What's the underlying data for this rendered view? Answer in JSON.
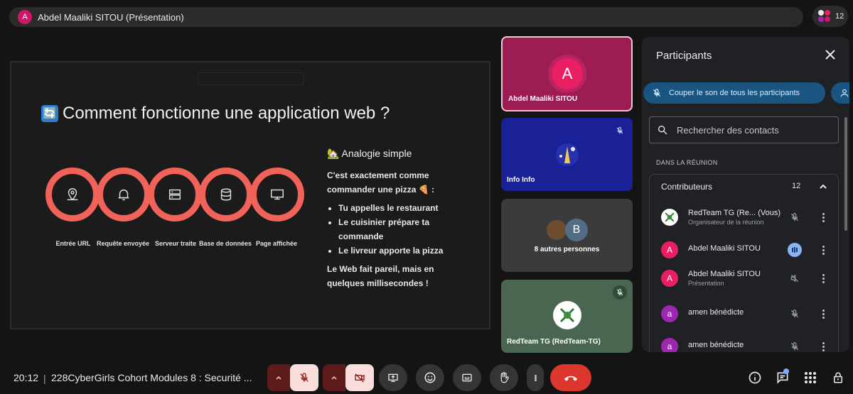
{
  "presenter_bar": {
    "avatar_letter": "A",
    "title": "Abdel Maaliki SITOU (Présentation)"
  },
  "people_chip": {
    "count": "12"
  },
  "slide": {
    "title": "Comment fonctionne une application web ?",
    "title_icon": "🔄",
    "steps": [
      {
        "label": "Entrée URL",
        "icon": "location-icon"
      },
      {
        "label": "Requête envoyée",
        "icon": "bell-icon"
      },
      {
        "label": "Serveur traite",
        "icon": "server-icon"
      },
      {
        "label": "Base de données",
        "icon": "database-icon"
      },
      {
        "label": "Page affichée",
        "icon": "monitor-icon"
      }
    ],
    "analogy": {
      "heading": "🏡 Analogie simple",
      "intro": "C'est exactement comme commander une pizza 🍕 :",
      "bullets": [
        "Tu appelles le restaurant",
        "Le cuisinier prépare ta commande",
        "Le livreur apporte la pizza"
      ],
      "outro": "Le Web fait pareil, mais en quelques millisecondes !"
    }
  },
  "tiles": [
    {
      "name": "Abdel Maaliki SITOU",
      "avatar_letter": "A"
    },
    {
      "name": "Info Info"
    },
    {
      "name": "8 autres personnes",
      "avatar_letter": "B"
    },
    {
      "name": "RedTeam TG (RedTeam-TG)"
    }
  ],
  "panel": {
    "title": "Participants",
    "mute_all": "Couper le son de tous les participants",
    "search_placeholder": "Rechercher des contacts",
    "section": "DANS LA RÉUNION",
    "group": {
      "label": "Contributeurs",
      "count": "12"
    },
    "participants": [
      {
        "name": "RedTeam TG (Re...  (Vous)",
        "sub": "Organisateur de la réunion",
        "avatar": "",
        "color": "#ffffff",
        "mic": "off"
      },
      {
        "name": "Abdel Maaliki SITOU",
        "sub": "",
        "avatar": "A",
        "color": "#e91e63",
        "mic": "speaking"
      },
      {
        "name": "Abdel Maaliki SITOU",
        "sub": "Présentation",
        "avatar": "A",
        "color": "#e91e63",
        "mic": "presenting"
      },
      {
        "name": "amen bénédicte",
        "sub": "",
        "avatar": "a",
        "color": "#9c27b0",
        "mic": "off"
      },
      {
        "name": "amen bénédicte",
        "sub": "",
        "avatar": "a",
        "color": "#9c27b0",
        "mic": "off"
      }
    ]
  },
  "bottom": {
    "time": "20:12",
    "separator": "|",
    "meeting_title": "228CyberGirls Cohort Modules 8 : Securité ..."
  }
}
